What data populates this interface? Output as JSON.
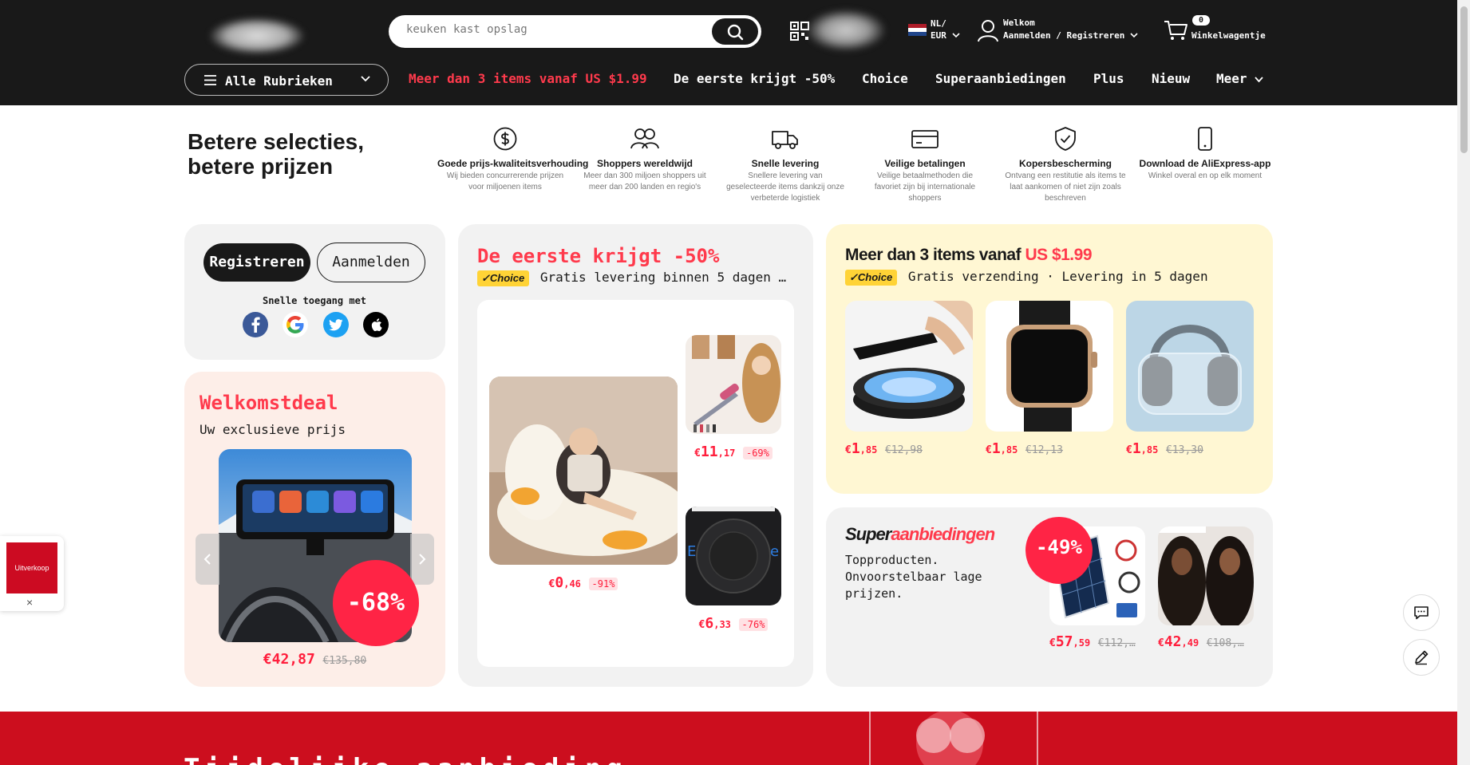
{
  "header": {
    "search_placeholder": "keuken kast opslag",
    "lang_line1": "NL/",
    "lang_line2": "EUR",
    "account_line1": "Welkom",
    "account_line2": "Aanmelden / Registreren",
    "cart_count": "0",
    "cart_label": "Winkelwagentje"
  },
  "nav": {
    "categories": "Alle Rubrieken",
    "items": [
      "Meer dan 3 items vanaf US $1.99",
      "De eerste krijgt -50%",
      "Choice",
      "Superaanbiedingen",
      "Plus",
      "Nieuw",
      "Meer"
    ]
  },
  "features": {
    "tagline_1": "Betere selecties,",
    "tagline_2": "betere prijzen",
    "items": [
      {
        "title": "Goede prijs-kwaliteitsverhouding",
        "desc": "Wij bieden concurrerende prijzen voor miljoenen items",
        "icon": "dollar-icon"
      },
      {
        "title": "Shoppers wereldwijd",
        "desc": "Meer dan 300 miljoen shoppers uit meer dan 200 landen en regio's",
        "icon": "users-icon"
      },
      {
        "title": "Snelle levering",
        "desc": "Snellere levering van geselecteerde items dankzij onze verbeterde logistiek",
        "icon": "truck-icon"
      },
      {
        "title": "Veilige betalingen",
        "desc": "Veilige betaalmethoden die favoriet zijn bij internationale shoppers",
        "icon": "card-icon"
      },
      {
        "title": "Kopersbescherming",
        "desc": "Ontvang een restitutie als items te laat aankomen of niet zijn zoals beschreven",
        "icon": "shield-icon"
      },
      {
        "title": "Download de AliExpress-app",
        "desc": "Winkel overal en op elk moment",
        "icon": "phone-icon"
      }
    ]
  },
  "login": {
    "register": "Registreren",
    "signin": "Aanmelden",
    "quick": "Snelle toegang met"
  },
  "welcome": {
    "title": "Welkomstdeal",
    "subtitle": "Uw exclusieve prijs",
    "discount": "-68%",
    "price": "€42,87",
    "old_price": "€135,80"
  },
  "first": {
    "title": "De eerste krijgt -50%",
    "choice": "Choice",
    "subtitle": "Gratis levering binnen 5 dagen …",
    "main": {
      "cur": "€",
      "int": "0",
      "dec": ",46",
      "pct": "-91%"
    },
    "p1": {
      "cur": "€",
      "int": "11",
      "dec": ",17",
      "pct": "-69%"
    },
    "p2": {
      "cur": "€",
      "int": "6",
      "dec": ",33",
      "pct": "-76%"
    }
  },
  "three": {
    "title_a": "Meer dan 3 items vanaf ",
    "title_b": "US $1.99",
    "choice": "Choice",
    "subtitle": "Gratis verzending · Levering in 5 dagen",
    "products": [
      {
        "cur": "€",
        "int": "1",
        "dec": ",85",
        "old": "€12,98"
      },
      {
        "cur": "€",
        "int": "1",
        "dec": ",85",
        "old": "€12,13"
      },
      {
        "cur": "€",
        "int": "1",
        "dec": ",85",
        "old": "€13,30"
      }
    ]
  },
  "super": {
    "logo_a": "Super",
    "logo_b": "aanbiedingen",
    "desc": "Topproducten. Onvoorstelbaar lage prijzen.",
    "badge": "-49%",
    "products": [
      {
        "cur": "€",
        "int": "57",
        "dec": ",59",
        "old": "€112,…"
      },
      {
        "cur": "€",
        "int": "42",
        "dec": ",49",
        "old": "€108,…"
      }
    ]
  },
  "sidebar_ad": {
    "label": "Uitverkoop",
    "close": "×"
  },
  "band": {
    "title": "Tijdelijke aanbieding"
  }
}
